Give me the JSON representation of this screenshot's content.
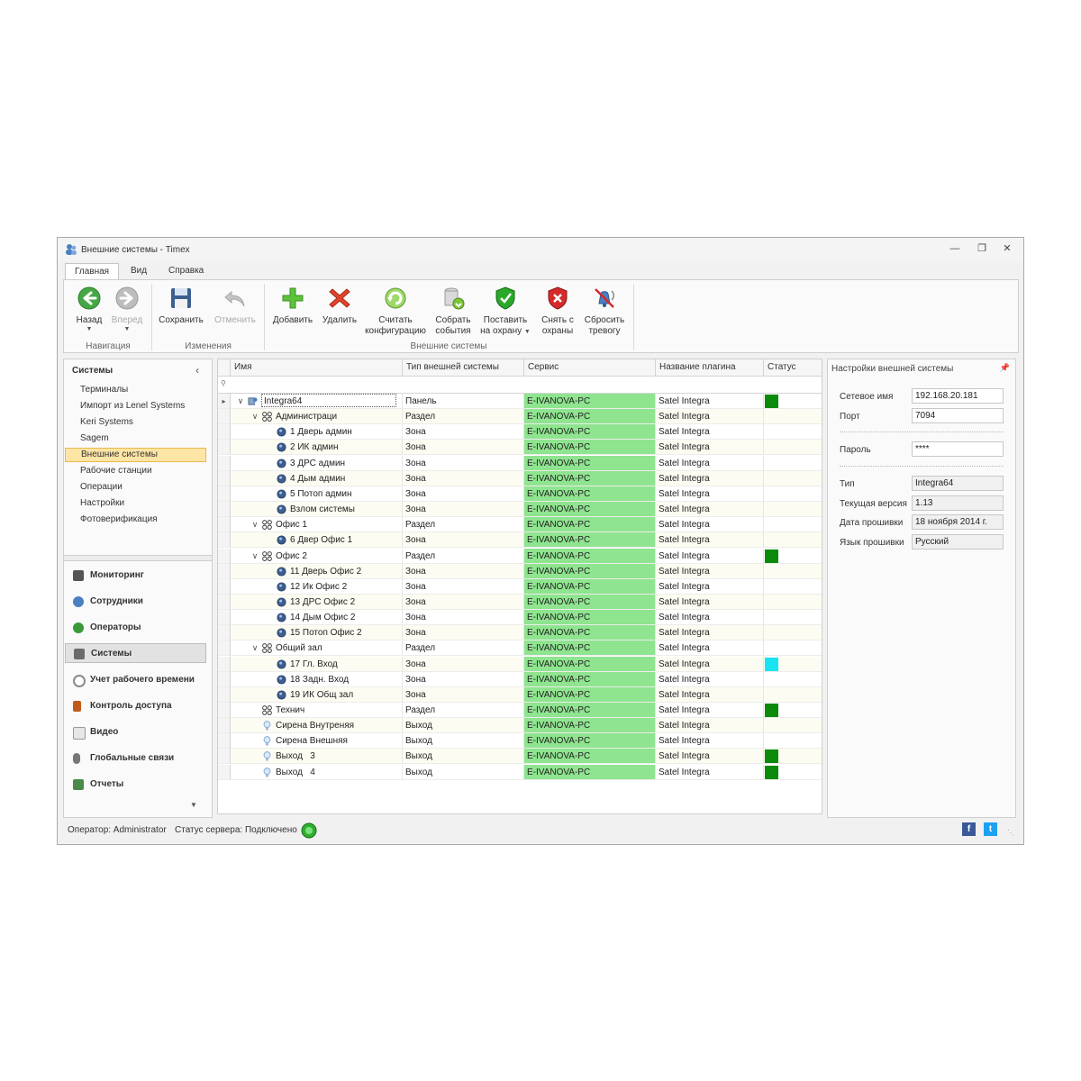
{
  "window": {
    "title": "Внешние системы - Timex",
    "controls": [
      "minimize",
      "restore",
      "close"
    ]
  },
  "tabs": [
    {
      "label": "Главная"
    },
    {
      "label": "Вид"
    },
    {
      "label": "Справка"
    }
  ],
  "ribbon": {
    "groups": [
      {
        "label": "Навигация"
      },
      {
        "label": "Изменения"
      },
      {
        "label": "Внешние системы"
      }
    ],
    "buttons": [
      {
        "label": "Назад",
        "icon": "back-arrow-icon"
      },
      {
        "label": "Вперед",
        "icon": "forward-arrow-icon"
      },
      {
        "label": "Сохранить",
        "icon": "save-icon"
      },
      {
        "label": "Отменить",
        "icon": "undo-icon"
      },
      {
        "label": "Добавить",
        "icon": "add-icon"
      },
      {
        "label": "Удалить",
        "icon": "delete-icon"
      },
      {
        "label": "Считать конфигурацию",
        "line1": "Считать",
        "line2": "конфигурацию",
        "icon": "refresh-icon"
      },
      {
        "label": "Собрать события",
        "line1": "Собрать",
        "line2": "события",
        "icon": "collect-events-icon"
      },
      {
        "label": "Поставить на охрану",
        "line1": "Поставить",
        "line2": "на охрану",
        "icon": "shield-arm-icon"
      },
      {
        "label": "Снять с охраны",
        "line1": "Снять с",
        "line2": "охраны",
        "icon": "shield-disarm-icon"
      },
      {
        "label": "Сбросить тревогу",
        "line1": "Сбросить",
        "line2": "тревогу",
        "icon": "reset-alarm-icon"
      }
    ]
  },
  "sidebar": {
    "header": "Системы",
    "items": [
      {
        "label": "Терминалы"
      },
      {
        "label": "Импорт из Lenel Systems"
      },
      {
        "label": "Keri Systems"
      },
      {
        "label": "Sagem"
      },
      {
        "label": "Внешние системы"
      },
      {
        "label": "Рабочие станции"
      },
      {
        "label": "Операции"
      },
      {
        "label": "Настройки"
      },
      {
        "label": "Фотоверификация"
      }
    ],
    "nav": [
      {
        "label": "Мониторинг",
        "icon": "monitor-icon",
        "color": "#555555"
      },
      {
        "label": "Сотрудники",
        "icon": "employees-icon",
        "color": "#4a7fc1"
      },
      {
        "label": "Операторы",
        "icon": "operators-icon",
        "color": "#3a9a3a"
      },
      {
        "label": "Системы",
        "icon": "systems-icon",
        "color": "#6b6b6b"
      },
      {
        "label": "Учет рабочего времени",
        "icon": "clock-icon",
        "color": "#8a8a8a"
      },
      {
        "label": "Контроль доступа",
        "icon": "door-icon",
        "color": "#c05a1a"
      },
      {
        "label": "Видео",
        "icon": "video-icon",
        "color": "#999999"
      },
      {
        "label": "Глобальные связи",
        "icon": "link-icon",
        "color": "#777777"
      },
      {
        "label": "Отчеты",
        "icon": "reports-icon",
        "color": "#4a8a4a"
      }
    ]
  },
  "grid": {
    "columns": [
      {
        "label": "Имя"
      },
      {
        "label": "Тип внешней системы"
      },
      {
        "label": "Сервис"
      },
      {
        "label": "Название плагина"
      },
      {
        "label": "Статус"
      }
    ],
    "filter_icon": "filter-icon",
    "rows": [
      {
        "name": "Integra64",
        "type": "Панель",
        "service": "E-IVANOVA-PC",
        "plugin": "Satel Integra",
        "status": "green",
        "level": 0,
        "icon": "panel-icon",
        "expanded": true
      },
      {
        "name": "Администраци",
        "type": "Раздел",
        "service": "E-IVANOVA-PC",
        "plugin": "Satel Integra",
        "status": "",
        "level": 1,
        "icon": "partition-icon",
        "expanded": true
      },
      {
        "name": "1 Дверь админ",
        "type": "Зона",
        "service": "E-IVANOVA-PC",
        "plugin": "Satel Integra",
        "status": "",
        "level": 2,
        "icon": "zone-icon"
      },
      {
        "name": "2 ИК админ",
        "type": "Зона",
        "service": "E-IVANOVA-PC",
        "plugin": "Satel Integra",
        "status": "",
        "level": 2,
        "icon": "zone-icon"
      },
      {
        "name": "3 ДРС админ",
        "type": "Зона",
        "service": "E-IVANOVA-PC",
        "plugin": "Satel Integra",
        "status": "",
        "level": 2,
        "icon": "zone-icon"
      },
      {
        "name": "4 Дым админ",
        "type": "Зона",
        "service": "E-IVANOVA-PC",
        "plugin": "Satel Integra",
        "status": "",
        "level": 2,
        "icon": "zone-icon"
      },
      {
        "name": "5 Потоп админ",
        "type": "Зона",
        "service": "E-IVANOVA-PC",
        "plugin": "Satel Integra",
        "status": "",
        "level": 2,
        "icon": "zone-icon"
      },
      {
        "name": "Взлом системы",
        "type": "Зона",
        "service": "E-IVANOVA-PC",
        "plugin": "Satel Integra",
        "status": "",
        "level": 2,
        "icon": "zone-icon"
      },
      {
        "name": "Офис 1",
        "type": "Раздел",
        "service": "E-IVANOVA-PC",
        "plugin": "Satel Integra",
        "status": "",
        "level": 1,
        "icon": "partition-icon",
        "expanded": true
      },
      {
        "name": "6 Двер Офис 1",
        "type": "Зона",
        "service": "E-IVANOVA-PC",
        "plugin": "Satel Integra",
        "status": "",
        "level": 2,
        "icon": "zone-icon"
      },
      {
        "name": "Офис 2",
        "type": "Раздел",
        "service": "E-IVANOVA-PC",
        "plugin": "Satel Integra",
        "status": "green",
        "level": 1,
        "icon": "partition-icon",
        "expanded": true
      },
      {
        "name": "11 Дверь Офис 2",
        "type": "Зона",
        "service": "E-IVANOVA-PC",
        "plugin": "Satel Integra",
        "status": "",
        "level": 2,
        "icon": "zone-icon"
      },
      {
        "name": "12 Ик Офис 2",
        "type": "Зона",
        "service": "E-IVANOVA-PC",
        "plugin": "Satel Integra",
        "status": "",
        "level": 2,
        "icon": "zone-icon"
      },
      {
        "name": "13 ДРС Офис 2",
        "type": "Зона",
        "service": "E-IVANOVA-PC",
        "plugin": "Satel Integra",
        "status": "",
        "level": 2,
        "icon": "zone-icon"
      },
      {
        "name": "14 Дым Офис 2",
        "type": "Зона",
        "service": "E-IVANOVA-PC",
        "plugin": "Satel Integra",
        "status": "",
        "level": 2,
        "icon": "zone-icon"
      },
      {
        "name": "15 Потоп Офис 2",
        "type": "Зона",
        "service": "E-IVANOVA-PC",
        "plugin": "Satel Integra",
        "status": "",
        "level": 2,
        "icon": "zone-icon"
      },
      {
        "name": "Общий зал",
        "type": "Раздел",
        "service": "E-IVANOVA-PC",
        "plugin": "Satel Integra",
        "status": "",
        "level": 1,
        "icon": "partition-icon",
        "expanded": true
      },
      {
        "name": "17 Гл. Вход",
        "type": "Зона",
        "service": "E-IVANOVA-PC",
        "plugin": "Satel Integra",
        "status": "cyan",
        "level": 2,
        "icon": "zone-icon"
      },
      {
        "name": "18 Задн. Вход",
        "type": "Зона",
        "service": "E-IVANOVA-PC",
        "plugin": "Satel Integra",
        "status": "",
        "level": 2,
        "icon": "zone-icon"
      },
      {
        "name": "19 ИК Общ зал",
        "type": "Зона",
        "service": "E-IVANOVA-PC",
        "plugin": "Satel Integra",
        "status": "",
        "level": 2,
        "icon": "zone-icon"
      },
      {
        "name": "Технич",
        "type": "Раздел",
        "service": "E-IVANOVA-PC",
        "plugin": "Satel Integra",
        "status": "green",
        "level": 1,
        "icon": "partition-icon"
      },
      {
        "name": "Сирена Внутреняя",
        "type": "Выход",
        "service": "E-IVANOVA-PC",
        "plugin": "Satel Integra",
        "status": "",
        "level": 1,
        "icon": "output-icon"
      },
      {
        "name": "Сирена Внешняя",
        "type": "Выход",
        "service": "E-IVANOVA-PC",
        "plugin": "Satel Integra",
        "status": "",
        "level": 1,
        "icon": "output-icon"
      },
      {
        "name": "Выход   3",
        "type": "Выход",
        "service": "E-IVANOVA-PC",
        "plugin": "Satel Integra",
        "status": "green",
        "level": 1,
        "icon": "output-icon"
      },
      {
        "name": "Выход   4",
        "type": "Выход",
        "service": "E-IVANOVA-PC",
        "plugin": "Satel Integra",
        "status": "green",
        "level": 1,
        "icon": "output-icon"
      }
    ]
  },
  "properties": {
    "header": "Настройки внешней системы",
    "fields": [
      {
        "label": "Сетевое имя",
        "value": "192.168.20.181",
        "readonly": false
      },
      {
        "label": "Порт",
        "value": "7094",
        "readonly": false
      },
      {
        "label": "Пароль",
        "value": "****",
        "readonly": false
      },
      {
        "label": "Тип",
        "value": "Integra64",
        "readonly": true
      },
      {
        "label": "Текущая версия",
        "value": "1.13",
        "readonly": true
      },
      {
        "label": "Дата прошивки",
        "value": "18 ноября 2014 г.",
        "readonly": true
      },
      {
        "label": "Язык прошивки",
        "value": "Русский",
        "readonly": true
      }
    ]
  },
  "statusbar": {
    "operator": "Оператор: Administrator",
    "server": "Статус сервера: Подключено",
    "social": [
      {
        "label": "f",
        "icon": "facebook-icon"
      },
      {
        "label": "t",
        "icon": "twitter-icon"
      }
    ]
  },
  "colors": {
    "service_bg": "#8fe48f",
    "status_green": "#0b8a0b",
    "status_cyan": "#19e4f4",
    "selected_item": "#fde5a5"
  }
}
